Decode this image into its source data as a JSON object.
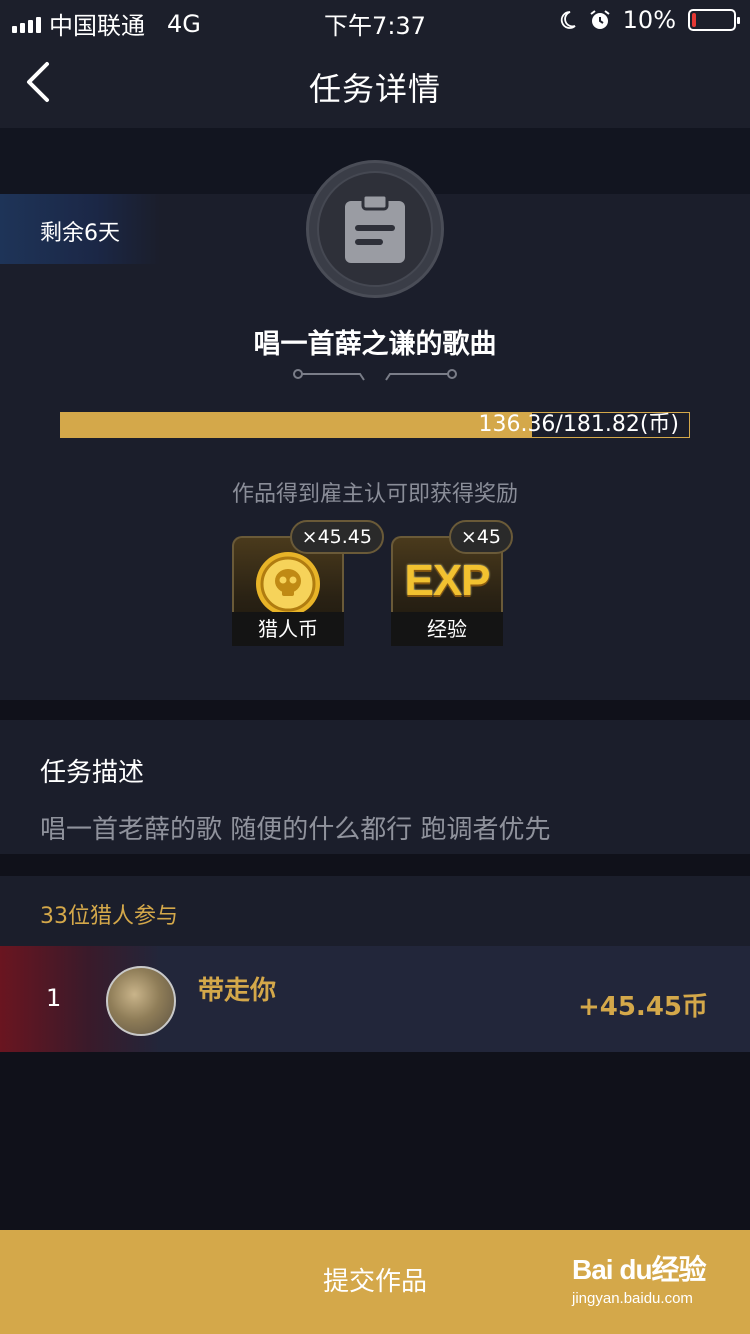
{
  "status_bar": {
    "carrier": "中国联通",
    "network": "4G",
    "time": "下午7:37",
    "battery_text": "10%",
    "battery_level": 0.1
  },
  "nav": {
    "title": "任务详情",
    "back_icon": "chevron-left-icon"
  },
  "task": {
    "days_left": "剩余6天",
    "title": "唱一首薛之谦的歌曲",
    "progress_text": "136.36/181.82(币)",
    "progress_fraction": 0.75,
    "reward_note": "作品得到雇主认可即获得奖励"
  },
  "rewards": [
    {
      "label": "猎人币",
      "amount": "×45.45",
      "icon": "skull-coin-icon"
    },
    {
      "label": "经验",
      "amount": "×45",
      "icon_text": "EXP"
    }
  ],
  "description": {
    "title": "任务描述",
    "text": "唱一首老薛的歌 随便的什么都行 跑调者优先"
  },
  "participants": {
    "count_label": "33位猎人参与",
    "rows": [
      {
        "rank": "1",
        "name": "带走你",
        "reward": "+45.45币"
      }
    ]
  },
  "submit_label": "提交作品",
  "watermark": {
    "logo": "Bai du经验",
    "url": "jingyan.baidu.com"
  },
  "colors": {
    "accent": "#d4a84a",
    "background": "#10111a",
    "panel": "#1b1e2b"
  }
}
